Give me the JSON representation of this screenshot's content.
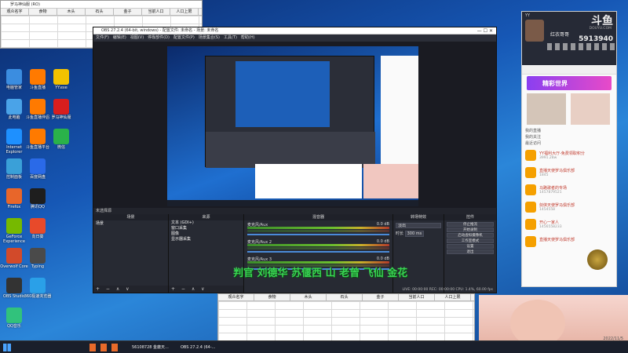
{
  "desktop": {
    "icons_col1": [
      {
        "label": "电脑管家",
        "color": "#3b8de0"
      },
      {
        "label": "此电脑",
        "color": "#4aa3e8"
      },
      {
        "label": "Internet Explorer",
        "color": "#1e90ff"
      },
      {
        "label": "控制面板",
        "color": "#3aa0d8"
      },
      {
        "label": "Firefox",
        "color": "#e8662a"
      },
      {
        "label": "GeForce Experience",
        "color": "#76b900"
      },
      {
        "label": "Overwolf Core",
        "color": "#d24a2a"
      },
      {
        "label": "OBS Studio",
        "color": "#333333"
      },
      {
        "label": "QQ音乐",
        "color": "#31c27c"
      }
    ],
    "icons_col2": [
      {
        "label": "斗鱼直播",
        "color": "#ff7a00"
      },
      {
        "label": "斗鱼直播伴侣",
        "color": "#ff7a00"
      },
      {
        "label": "斗鱼直播平台",
        "color": "#ff7a00"
      },
      {
        "label": "百度网盘",
        "color": "#2a6ae8"
      },
      {
        "label": "腾讯QQ",
        "color": "#1e1e1e"
      },
      {
        "label": "向日葵",
        "color": "#e84a2a"
      },
      {
        "label": "Typing",
        "color": "#4a4a4a"
      },
      {
        "label": "360极速浏览器",
        "color": "#2aa0e8"
      }
    ],
    "icons_col3": [
      {
        "label": "YY.exe",
        "color": "#f2c200"
      },
      {
        "label": "罗马神仙服",
        "color": "#d81e1e"
      },
      {
        "label": "微信",
        "color": "#2ab24a"
      }
    ]
  },
  "spreadsheet_top": {
    "title": "罗马神仙服 (RO)",
    "columns": [
      "观众名字",
      "食物",
      "木头",
      "石头",
      "金子",
      "当前人口",
      "人口上限"
    ]
  },
  "spreadsheet_bottom": {
    "columns": [
      "观众名字",
      "食物",
      "木头",
      "石头",
      "金子",
      "当前人口",
      "人口上限"
    ]
  },
  "obs": {
    "title": "OBS 27.2.4 (64-bit, windows) - 配置文件: 未命名 - 场景: 未命名",
    "menu": [
      "文件(F)",
      "编辑(E)",
      "视图(V)",
      "停靠部件(D)",
      "配置文件(P)",
      "场景集合(S)",
      "工具(T)",
      "帮助(H)"
    ],
    "status_label": "未选择源",
    "docks": {
      "scenes": "场景",
      "sources": "来源",
      "mixer": "混音器",
      "transitions": "转场特效",
      "controls": "控件"
    },
    "scenes_list": [
      "场景"
    ],
    "sources_list": [
      "文本 (GDI+)",
      "窗口采集",
      "图像",
      "显示器采集"
    ],
    "mixer_tracks": [
      {
        "name": "麦克风/Aux",
        "level": "0.0 dB"
      },
      {
        "name": "麦克风/Aux 2",
        "level": "0.0 dB"
      },
      {
        "name": "麦克风/Aux 3",
        "level": "0.0 dB"
      }
    ],
    "transition": {
      "type": "淡出",
      "duration_label": "时长",
      "duration": "300 ms"
    },
    "control_buttons": [
      "停止推流",
      "开始录制",
      "启动虚拟摄像机",
      "工作室模式",
      "设置",
      "退出"
    ],
    "footer_symbols": "+ − ∧ ∨",
    "overlay_text": "判官 刘德华 苏偃西 山 老曾 飞仙 金花",
    "status_bar": "LIVE: 00:00:00  REC: 00:00:00  CPU: 1.4%, 60.00 fps"
  },
  "douyu": {
    "brand": "斗鱼",
    "brand_sub": "DOUYU.COM",
    "user_name": "YY",
    "room_title": "红衣哥哥",
    "fans_count": "5913940",
    "banner_text": "精彩世界",
    "section_labels": [
      "我的直播",
      "我的关注",
      "最近访问"
    ],
    "list": [
      {
        "title": "YY福利大厅-免费领取积分",
        "sub": "3991.28w"
      },
      {
        "title": "直播天使罗马俱乐部",
        "sub": "1845"
      },
      {
        "title": "马路歌者的专场",
        "sub": "1457879521"
      },
      {
        "title": "剑侠天使罗马俱乐部",
        "sub": "1454558"
      },
      {
        "title": "开心一家人",
        "sub": "1456558233"
      },
      {
        "title": "直播天使罗马俱乐部",
        "sub": ""
      }
    ]
  },
  "taskbar": {
    "items": [
      "56108728 金庸天...",
      "OBS 27.2.4 (64-..."
    ],
    "clock": "2022/11/5"
  }
}
